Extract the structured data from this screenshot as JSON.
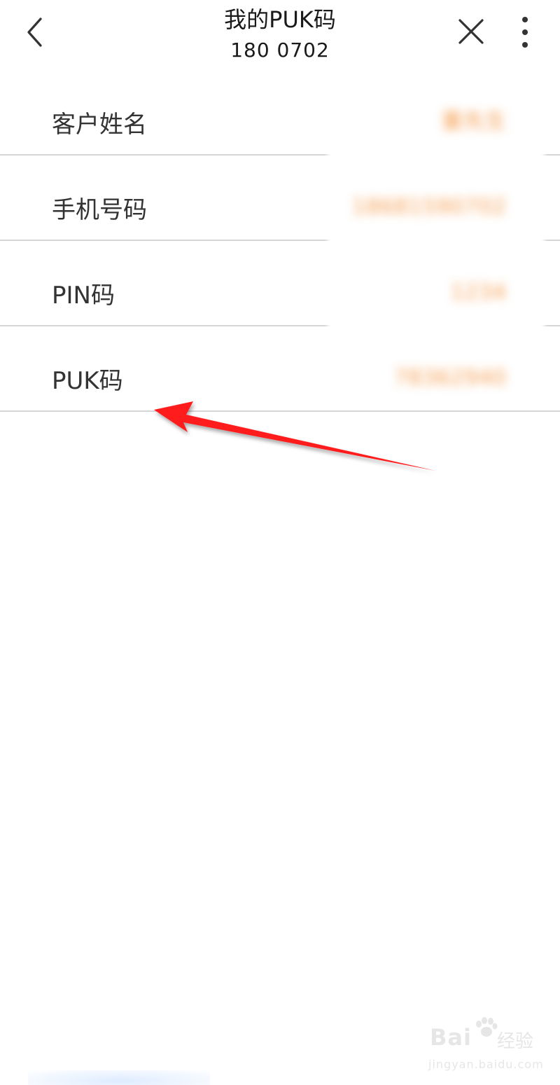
{
  "header": {
    "title": "我的PUK码",
    "subtitle": "180 0702"
  },
  "info": {
    "rows": [
      {
        "label": "客户姓名",
        "value": "董先生"
      },
      {
        "label": "手机号码",
        "value": "18681590702"
      },
      {
        "label": "PIN码",
        "value": "1234"
      },
      {
        "label": "PUK码",
        "value": "78362940"
      }
    ]
  },
  "watermark": {
    "brand": "Bai",
    "brand_suffix": "经验",
    "url": "jingyan.baidu.com"
  },
  "colors": {
    "value_text": "#f59a4a",
    "arrow": "#ff1a1a",
    "divider": "#d6d6d6"
  },
  "icons": {
    "back": "chevron-left-icon",
    "close": "close-icon",
    "more": "more-vertical-icon"
  }
}
